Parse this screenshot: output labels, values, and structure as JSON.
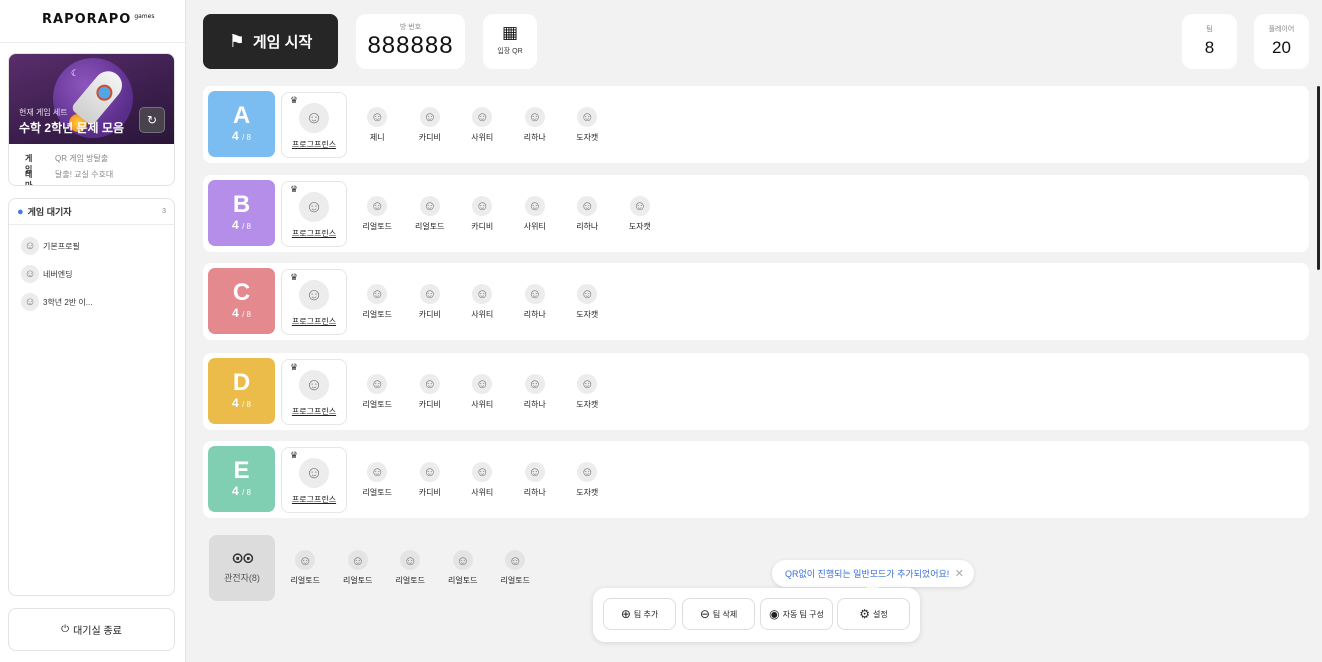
{
  "sidebar": {
    "logo": "RAPORAPO",
    "logo_sup": "games",
    "game": {
      "label": "현재 게임 세트",
      "title": "수학 2학년 문제 모음",
      "game_key": "게임",
      "game_val": "QR 게임 방탈출",
      "theme_key": "테마",
      "theme_val": "달출! 교실 수호대"
    },
    "waiting": {
      "title": "게임 대기자",
      "count": "3",
      "items": [
        "기본프로필",
        "네버엔딩",
        "3학년 2반 이..."
      ]
    },
    "exit_label": "대기실 종료"
  },
  "topbar": {
    "start_label": "게임 시작",
    "room_label": "방 번호",
    "room_number": "888888",
    "qr_label": "입장 QR",
    "team_label": "팀",
    "team_count": "8",
    "player_label": "플레이어",
    "player_count": "20"
  },
  "teams": [
    {
      "letter": "A",
      "count": "4",
      "max": "/ 8",
      "color": "#7bbcf1",
      "leader": "프로그프린스",
      "members": [
        "제니",
        "카디비",
        "사위티",
        "리하나",
        "도자캣"
      ]
    },
    {
      "letter": "B",
      "count": "4",
      "max": "/ 8",
      "color": "#b48ee9",
      "leader": "프로그프린스",
      "members": [
        "리얼토드",
        "리얼토드",
        "카디비",
        "사위티",
        "리하나",
        "도자캣"
      ]
    },
    {
      "letter": "C",
      "count": "4",
      "max": "/ 8",
      "color": "#e48a8e",
      "leader": "프로그프린스",
      "members": [
        "리얼토드",
        "카디비",
        "사위티",
        "리하나",
        "도자캣"
      ]
    },
    {
      "letter": "D",
      "count": "4",
      "max": "/ 8",
      "color": "#ebbc4a",
      "leader": "프로그프린스",
      "members": [
        "리얼토드",
        "카디비",
        "사위티",
        "리하나",
        "도자캣"
      ]
    },
    {
      "letter": "E",
      "count": "4",
      "max": "/ 8",
      "color": "#80cfb3",
      "leader": "프로그프린스",
      "members": [
        "리얼토드",
        "카디비",
        "사위티",
        "리하나",
        "도자캣"
      ]
    }
  ],
  "spectators": {
    "label": "관전자(8)",
    "members": [
      "리얼토드",
      "리얼토드",
      "리얼토드",
      "리얼토드",
      "리얼토드"
    ]
  },
  "toolbar": {
    "toast": "QR없이 진행되는 일반모드가 추가되었어요!",
    "add_team": "팀 추가",
    "delete_team": "팀 삭제",
    "auto_team": "자동 팀 구성",
    "settings": "설정"
  }
}
